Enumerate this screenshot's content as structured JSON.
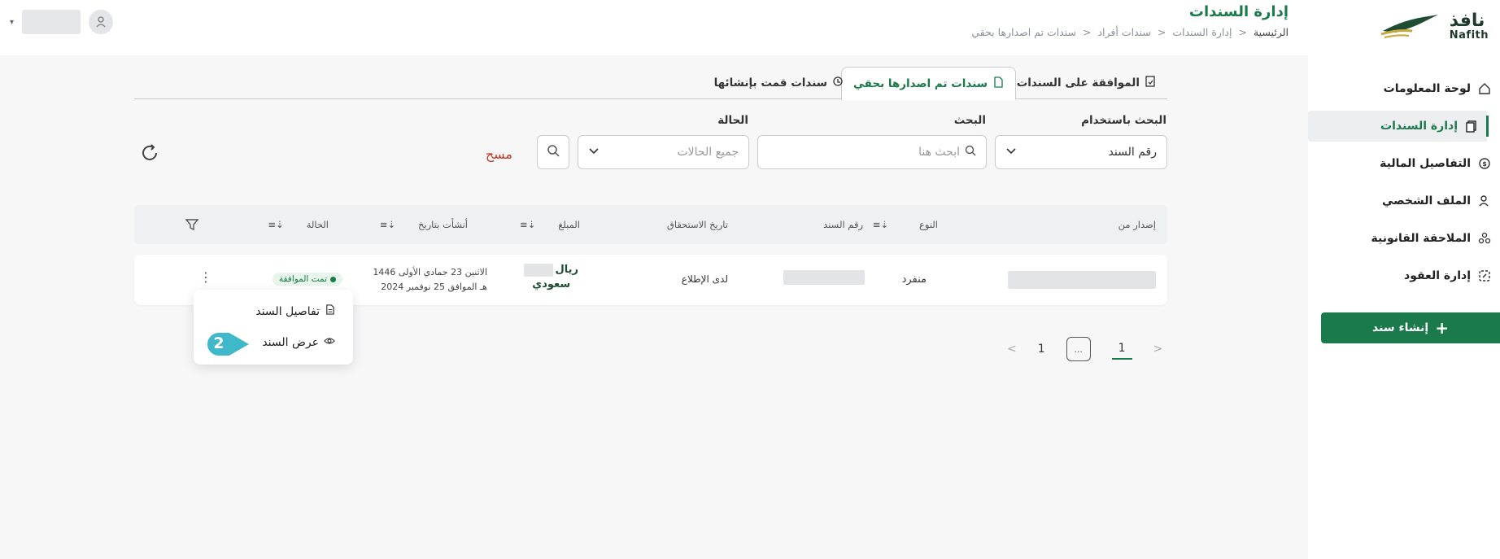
{
  "brand": {
    "name_ar": "نافذ",
    "name_en": "Nafith"
  },
  "header": {
    "title": "إدارة السندات",
    "breadcrumb": [
      "الرئيسية",
      "إدارة السندات",
      "سندات أفراد",
      "سندات تم اصدارها بحقي"
    ]
  },
  "sidebar": {
    "items": [
      {
        "label": "لوحة المعلومات",
        "icon": "home-icon"
      },
      {
        "label": "إدارة السندات",
        "icon": "documents-icon",
        "active": true
      },
      {
        "label": "التفاصيل المالية",
        "icon": "money-icon"
      },
      {
        "label": "الملف الشخصي",
        "icon": "profile-icon"
      },
      {
        "label": "الملاحقة القانونية",
        "icon": "legal-icon"
      },
      {
        "label": "إدارة العقود",
        "icon": "contract-icon"
      }
    ],
    "create_button": "إنشاء سند"
  },
  "tabs": [
    {
      "label": "الموافقة على السندات"
    },
    {
      "label": "سندات تم اصدارها بحقي",
      "active": true
    },
    {
      "label": "سندات قمت بإنشائها"
    }
  ],
  "filters": {
    "search_by_label": "البحث باستخدام",
    "search_by_value": "رقم السند",
    "search_label": "البحث",
    "search_placeholder": "ابحث هنا",
    "status_label": "الحالة",
    "status_value": "جميع الحالات",
    "clear_label": "مسح"
  },
  "table": {
    "headers": [
      "إصدار من",
      "النوع",
      "رقم السند",
      "تاريخ الاستحقاق",
      "المبلغ",
      "أنشأت بتاريخ",
      "الحالة"
    ],
    "rows": [
      {
        "type": "منفرد",
        "due_date": "لدى الإطلاع",
        "currency_line1": "ريال",
        "currency_line2": "سعودي",
        "created_line1": "الاثنين 23 جمادي الأولى 1446",
        "created_line2": "هـ الموافق 25 نوفمبر 2024",
        "status": "تمت الموافقة",
        "actions_icon": "⋮"
      }
    ]
  },
  "row_menu": {
    "items": [
      "تفاصيل السند",
      "عرض السند"
    ],
    "callout_number": "2"
  },
  "pagination": {
    "pages": [
      "1",
      "1"
    ],
    "ellipsis": "..."
  },
  "colors": {
    "brand_green": "#1a7a4c",
    "callout": "#3fb8c9",
    "clear_red": "#c0392b"
  }
}
